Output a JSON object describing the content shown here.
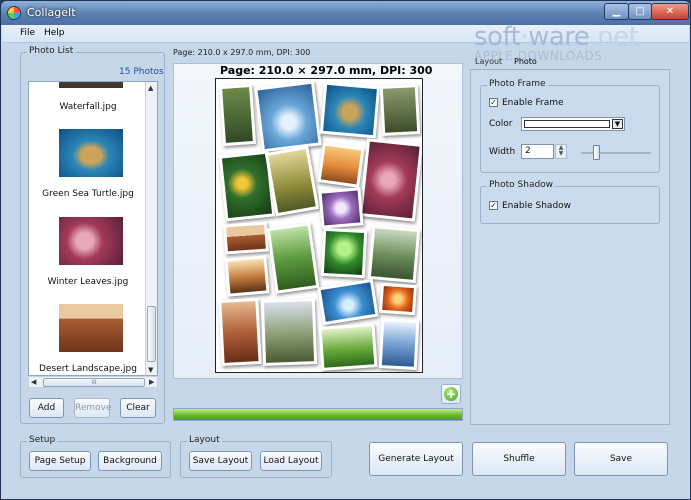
{
  "window": {
    "title": "CollageIt"
  },
  "menu": {
    "file": "File",
    "help": "Help"
  },
  "watermark": {
    "logo_part1": "soft",
    "logo_part2": "ware",
    "logo_part3": ".net",
    "subtitle": "APPLE DOWNLOADS"
  },
  "photo_list": {
    "title": "Photo List",
    "count": "15 Photos",
    "items": [
      {
        "caption": "Waterfall.jpg",
        "icon": "waterfall-thumbnail"
      },
      {
        "caption": "Green Sea Turtle.jpg",
        "icon": "sea-turtle-thumbnail"
      },
      {
        "caption": "Winter Leaves.jpg",
        "icon": "winter-leaves-thumbnail"
      },
      {
        "caption": "Desert Landscape.jpg",
        "icon": "desert-landscape-thumbnail"
      }
    ],
    "scroll_grip": "III",
    "add_label": "Add",
    "remove_label": "Remove",
    "clear_label": "Clear"
  },
  "page_info": "Page: 210.0 x 297.0 mm, DPI: 300",
  "canvas_info": "Page: 210.0 × 297.0 mm, DPI: 300",
  "right_panel": {
    "tab_layout": "Layout",
    "tab_photo": "Photo",
    "photo_frame": {
      "title": "Photo Frame",
      "enable_label": "Enable Frame",
      "enabled": true,
      "color_label": "Color",
      "color_value": "#ffffff",
      "width_label": "Width",
      "width_value": "2"
    },
    "photo_shadow": {
      "title": "Photo Shadow",
      "enable_label": "Enable Shadow",
      "enabled": true
    }
  },
  "setup": {
    "title": "Setup",
    "page_setup": "Page Setup",
    "background": "Background"
  },
  "layout": {
    "title": "Layout",
    "save_layout": "Save Layout",
    "load_layout": "Load Layout"
  },
  "actions": {
    "generate": "Generate Layout",
    "shuffle": "Shuffle",
    "save": "Save"
  },
  "colors": {
    "accent": "#5f82b4",
    "progress": "#63b52a",
    "panel": "#c6d7ea"
  },
  "icons": {
    "minimize": "minimize-icon",
    "maximize": "maximize-icon",
    "close": "close-icon",
    "add_photo": "add-photo-icon"
  },
  "progress": {
    "value": 1.0
  }
}
